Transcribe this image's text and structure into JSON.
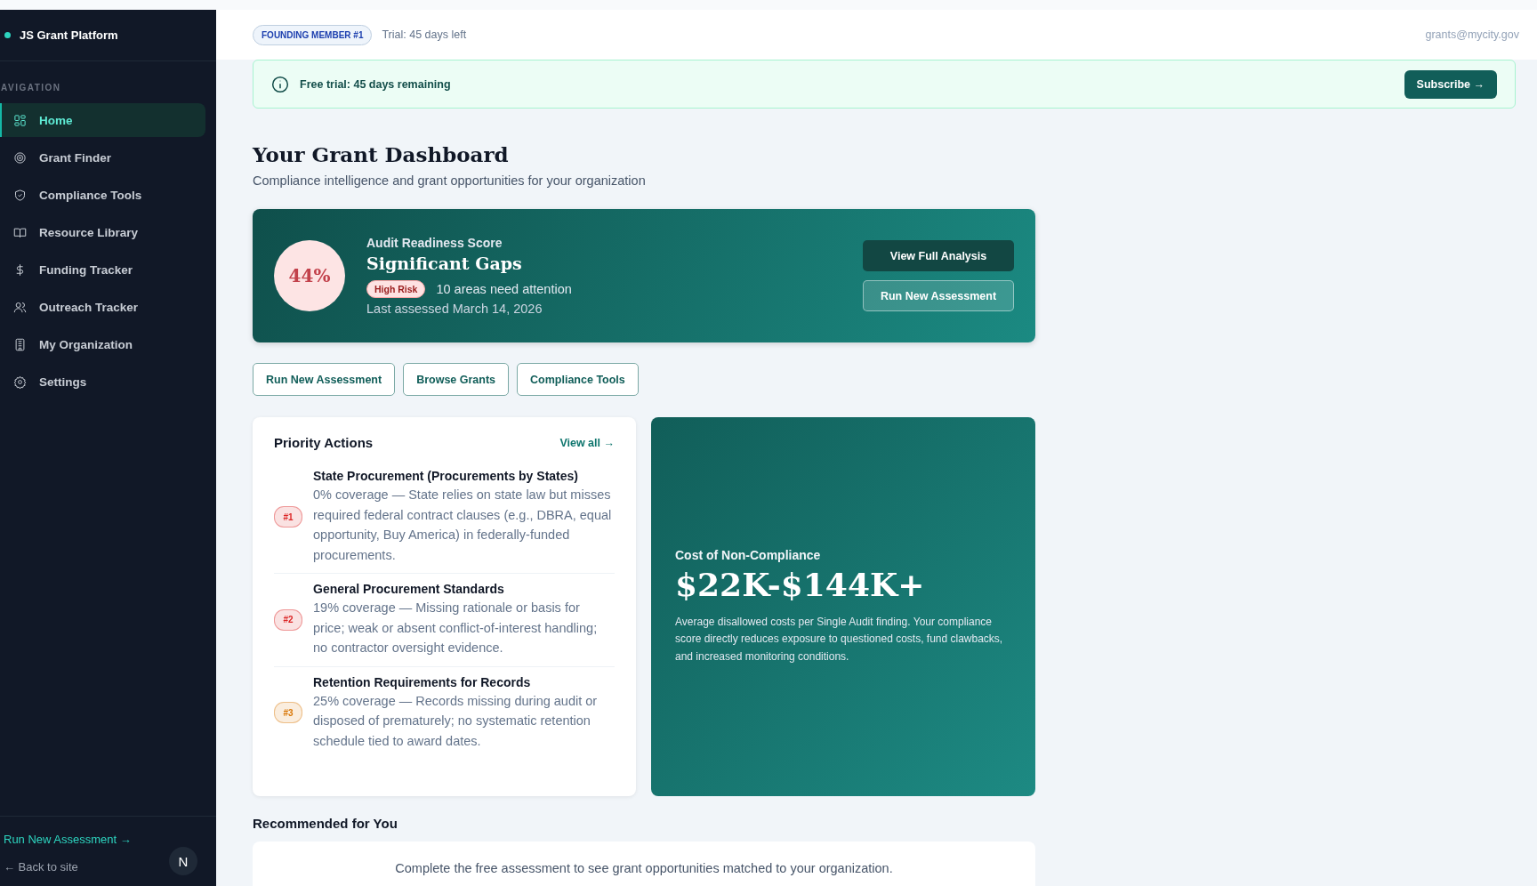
{
  "sidebar": {
    "brand": "JS Grant Platform",
    "section_label": "AVIGATION",
    "items": [
      {
        "label": "Home",
        "kind": "grid",
        "selected": true
      },
      {
        "label": "Grant Finder",
        "kind": "target",
        "selected": false
      },
      {
        "label": "Compliance Tools",
        "kind": "shield",
        "selected": false
      },
      {
        "label": "Resource Library",
        "kind": "book",
        "selected": false
      },
      {
        "label": "Funding Tracker",
        "kind": "dollar",
        "selected": false
      },
      {
        "label": "Outreach Tracker",
        "kind": "users",
        "selected": false
      },
      {
        "label": "My Organization",
        "kind": "building",
        "selected": false
      },
      {
        "label": "Settings",
        "kind": "gear",
        "selected": false
      }
    ],
    "footer_link": "Run New Assessment →",
    "back_link": "← Back to site",
    "dev_badge": "N"
  },
  "topbar": {
    "badge": "FOUNDING MEMBER #1",
    "trial": "Trial: 45 days left",
    "email": "grants@mycity.gov"
  },
  "banner": {
    "message": "Free trial: 45 days remaining",
    "button": "Subscribe →"
  },
  "page": {
    "title": "Your Grant Dashboard",
    "subtitle": "Compliance intelligence and grant opportunities for your organization"
  },
  "score_card": {
    "score": "44%",
    "label": "Audit Readiness Score",
    "status": "Significant Gaps",
    "risk": "High Risk",
    "areas": "10 areas need attention",
    "last_assessed": "Last assessed March 14, 2026",
    "buttons": [
      "View Full Analysis",
      "Run New Assessment"
    ]
  },
  "quick_actions": [
    "Run New Assessment",
    "Browse Grants",
    "Compliance Tools"
  ],
  "priority_actions": {
    "title": "Priority Actions",
    "view_all": "View all →",
    "items": [
      {
        "rank": "#1",
        "color": "#dc2626",
        "title": "State Procurement (Procurements by States)",
        "detail": "0% coverage — State relies on state law but misses required federal contract clauses (e.g., DBRA, equal opportunity, Buy America) in federally-funded procurements."
      },
      {
        "rank": "#2",
        "color": "#dc2626",
        "title": "General Procurement Standards",
        "detail": "19% coverage — Missing rationale or basis for price; weak or absent conflict-of-interest handling; no contractor oversight evidence."
      },
      {
        "rank": "#3",
        "color": "#d97706",
        "title": "Retention Requirements for Records",
        "detail": "25% coverage — Records missing during audit or disposed of prematurely; no systematic retention schedule tied to award dates."
      }
    ]
  },
  "cost_card": {
    "label": "Cost of Non-Compliance",
    "amount": "$22K-$144K+",
    "text": "Average disallowed costs per Single Audit finding. Your compliance score directly reduces exposure to questioned costs, fund clawbacks, and increased monitoring conditions."
  },
  "recommended": {
    "title": "Recommended for You",
    "message": "Complete the free assessment to see grant opportunities matched to your organization."
  }
}
